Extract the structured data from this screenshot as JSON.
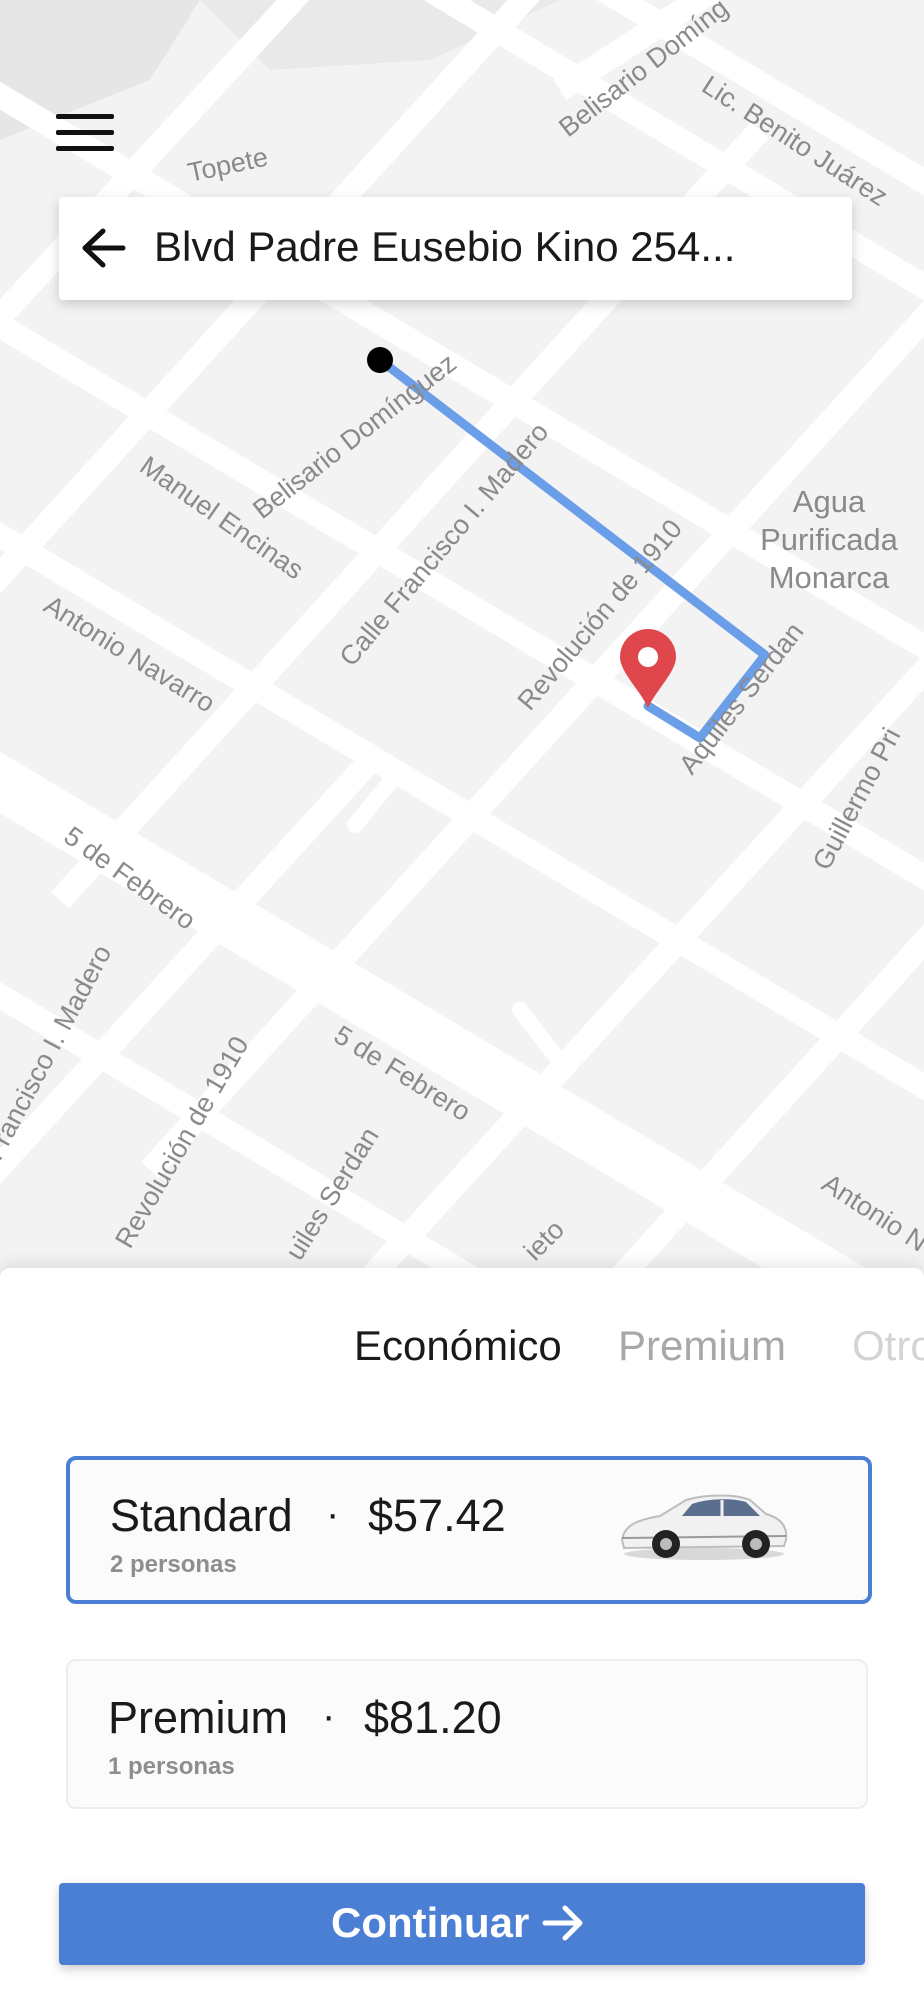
{
  "map": {
    "streets": [
      "Topete",
      "Belisario Domíng",
      "Lic. Benito Juárez",
      "Belisario Domínguez",
      "Manuel Encinas",
      "Calle Francisco I. Madero",
      "Revolución de 1910",
      "Antonio Navarro",
      "Aquiles Serdan",
      "Guillermo Pri",
      "5 de Febrero",
      "Francisco I. Madero",
      "Revolución de 1910",
      "5 de Febrero",
      "uiles Serdan",
      "ieto",
      "Antonio N"
    ],
    "poi": [
      "Agua",
      "Purificada",
      "Monarca"
    ],
    "route_color": "#6b9ee8",
    "pin_color": "#e0474c"
  },
  "header": {
    "menu_icon": "hamburger-menu-icon",
    "back_icon": "arrow-left-icon",
    "destination": "Blvd Padre Eusebio Kino 254..."
  },
  "tabs": [
    {
      "label": "Económico",
      "active": true
    },
    {
      "label": "Premium",
      "active": false
    },
    {
      "label": "Otro",
      "active": false
    }
  ],
  "rides": [
    {
      "name": "Standard",
      "separator": "·",
      "price": "$57.42",
      "capacity": "2 personas",
      "selected": true,
      "icon": "car-icon"
    },
    {
      "name": "Premium",
      "separator": "·",
      "price": "$81.20",
      "capacity": "1 personas",
      "selected": false
    }
  ],
  "continue_button": {
    "label": "Continuar",
    "icon": "arrow-right-icon",
    "color": "#4a7fd3"
  }
}
